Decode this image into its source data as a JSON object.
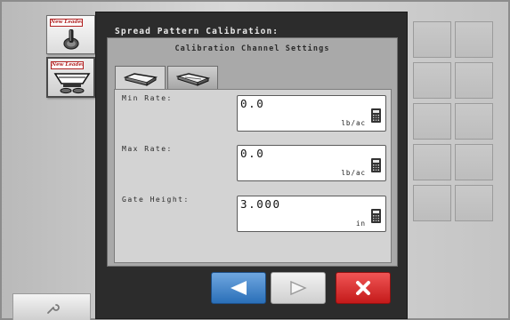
{
  "sidebar": {
    "apps": [
      {
        "brand": "New Leader",
        "icon": "toggle-switch-icon",
        "selected": false
      },
      {
        "brand": "New Leader",
        "icon": "spreader-hopper-icon",
        "selected": true
      }
    ],
    "tool_icon": "wrench-icon"
  },
  "dialog": {
    "title": "Spread Pattern Calibration:",
    "subtitle": "Calibration Channel Settings",
    "tabs": [
      {
        "icon": "spinner-disc-icon",
        "active": true
      },
      {
        "icon": "spinner-disc-alt-icon",
        "active": false
      }
    ],
    "fields": [
      {
        "label": "Min Rate:",
        "value": "0.0",
        "unit": "lb/ac"
      },
      {
        "label": "Max Rate:",
        "value": "0.0",
        "unit": "lb/ac"
      },
      {
        "label": "Gate Height:",
        "value": "3.000",
        "unit": "in"
      }
    ],
    "calculator_icon": "calculator-icon"
  },
  "nav": {
    "back_icon": "arrow-left-icon",
    "next_icon": "arrow-right-icon",
    "cancel_icon": "close-x-icon"
  },
  "colors": {
    "back": "#2a6fb8",
    "cancel": "#c41a1a",
    "brand": "#b22222"
  }
}
